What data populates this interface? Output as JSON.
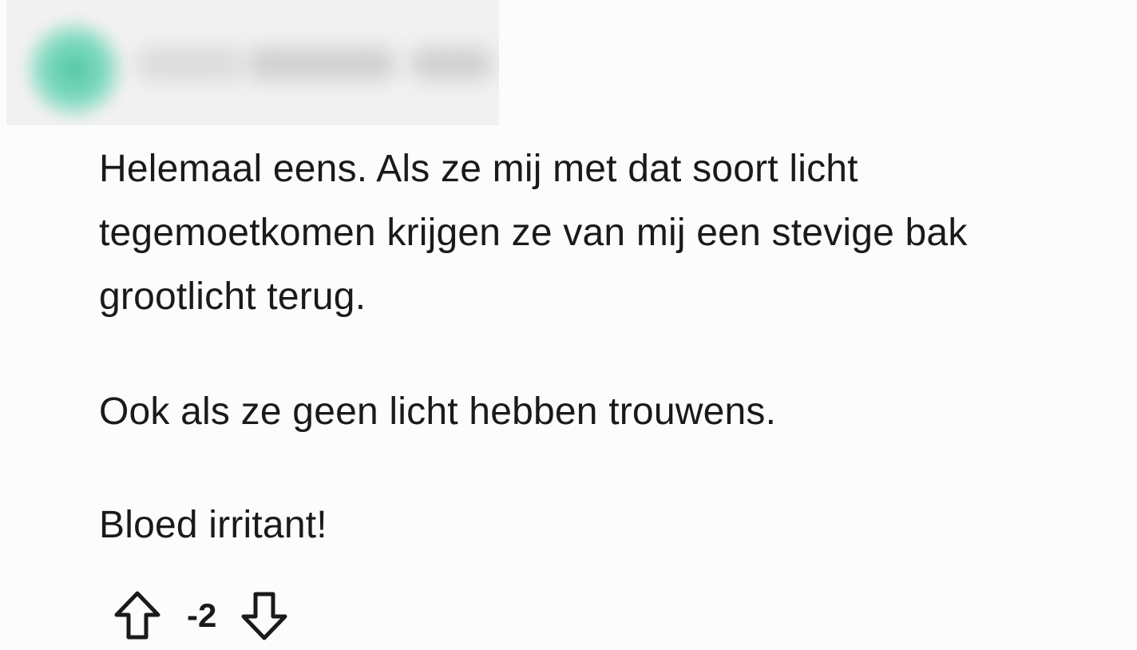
{
  "comment": {
    "paragraphs": [
      "Helemaal eens. Als ze mij met dat soort licht",
      "tegemoetkomen krijgen ze van mij een stevige bak",
      "grootlicht terug.",
      "Ook als ze geen licht hebben trouwens.",
      "Bloed irritant!"
    ]
  },
  "votes": {
    "score": "-2",
    "upvote_icon": "arrow-up-outline-icon",
    "downvote_icon": "arrow-down-outline-icon"
  },
  "colors": {
    "text": "#1a1a1b",
    "background": "#fcfcfc",
    "avatar_blur": "#55c9a7"
  }
}
